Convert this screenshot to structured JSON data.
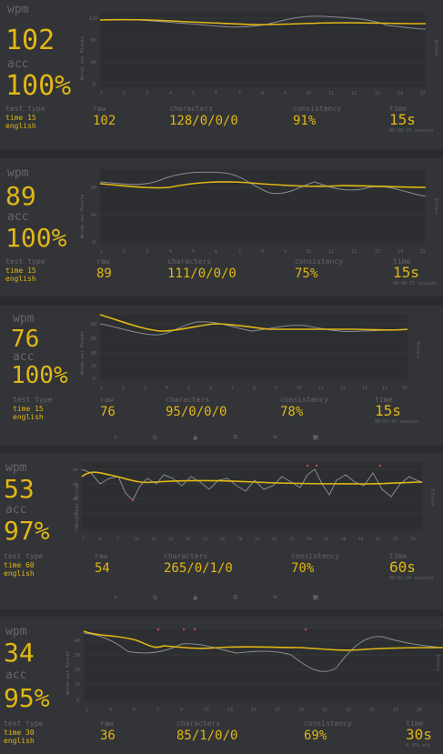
{
  "panels": [
    {
      "wpm_label": "wpm",
      "wpm": "102",
      "acc_label": "acc",
      "acc": "100%",
      "test_type_label": "test type",
      "test_type": "time 15",
      "language": "english",
      "raw_label": "raw",
      "raw": "102",
      "characters_label": "characters",
      "characters": "128/0/0/0",
      "consistency_label": "consistency",
      "consistency": "91%",
      "time_label": "time",
      "time": "15s",
      "time_note": "00:00:15 session",
      "y_axis_label": "Words per Minute",
      "y2_axis_label": "Errors",
      "y_ticks": [
        "120",
        "80",
        "40",
        "0"
      ],
      "x_ticks": [
        "1",
        "2",
        "3",
        "4",
        "5",
        "6",
        "7",
        "8",
        "9",
        "10",
        "11",
        "12",
        "13",
        "14",
        "15"
      ]
    },
    {
      "wpm_label": "wpm",
      "wpm": "89",
      "acc_label": "acc",
      "acc": "100%",
      "test_type_label": "test type",
      "test_type": "time 15",
      "language": "english",
      "raw_label": "raw",
      "raw": "89",
      "characters_label": "characters",
      "characters": "111/0/0/0",
      "consistency_label": "consistency",
      "consistency": "75%",
      "time_label": "time",
      "time": "15s",
      "time_note": "00:00:15 session",
      "y_axis_label": "Words per Minute",
      "y2_axis_label": "Errors",
      "y_ticks": [
        "80",
        "40",
        "0"
      ],
      "x_ticks": [
        "1",
        "2",
        "3",
        "4",
        "5",
        "6",
        "7",
        "8",
        "9",
        "10",
        "11",
        "12",
        "13",
        "14",
        "15"
      ]
    },
    {
      "wpm_label": "wpm",
      "wpm": "76",
      "acc_label": "acc",
      "acc": "100%",
      "test_type_label": "test type",
      "test_type": "time 15",
      "language": "english",
      "raw_label": "raw",
      "raw": "76",
      "characters_label": "characters",
      "characters": "95/0/0/0",
      "consistency_label": "consistency",
      "consistency": "78%",
      "time_label": "time",
      "time": "15s",
      "time_note": "00:00:45 session",
      "y_axis_label": "Words per Minute",
      "y2_axis_label": "Errors",
      "y_ticks": [
        "80",
        "60",
        "40",
        "20",
        "0"
      ],
      "x_ticks": [
        "1",
        "2",
        "3",
        "4",
        "5",
        "6",
        "7",
        "8",
        "9",
        "10",
        "11",
        "12",
        "13",
        "14",
        "15"
      ]
    },
    {
      "wpm_label": "wpm",
      "wpm": "53",
      "acc_label": "acc",
      "acc": "97%",
      "test_type_label": "test type",
      "test_type": "time 60",
      "language": "english",
      "raw_label": "raw",
      "raw": "54",
      "characters_label": "characters",
      "characters": "265/0/1/0",
      "consistency_label": "consistency",
      "consistency": "70%",
      "time_label": "time",
      "time": "60s",
      "time_note": "00:01:00 session",
      "y_axis_label": "Words per Minute",
      "y2_axis_label": "Errors",
      "y_ticks": [
        "80",
        "60",
        "40",
        "20",
        "0"
      ],
      "x_ticks": [
        "1",
        "4",
        "7",
        "10",
        "13",
        "16",
        "19",
        "22",
        "25",
        "28",
        "31",
        "34",
        "37",
        "40",
        "43",
        "46",
        "49",
        "52",
        "55",
        "58"
      ]
    },
    {
      "wpm_label": "wpm",
      "wpm": "34",
      "acc_label": "acc",
      "acc": "95%",
      "test_type_label": "test type",
      "test_type": "time 30",
      "language": "english",
      "raw_label": "raw",
      "raw": "36",
      "characters_label": "characters",
      "characters": "85/1/0/0",
      "consistency_label": "consistency",
      "consistency": "69%",
      "time_label": "time",
      "time": "30s",
      "time_note": "0.35% afk",
      "y_axis_label": "Words per Minute",
      "y2_axis_label": "Errors",
      "y_ticks": [
        "40",
        "30",
        "20",
        "10",
        "0"
      ],
      "x_ticks": [
        "1",
        "3",
        "5",
        "7",
        "9",
        "11",
        "13",
        "15",
        "17",
        "19",
        "21",
        "23",
        "25",
        "27",
        "29"
      ]
    }
  ],
  "toolbar_icons": [
    "next-test-icon",
    "restart-icon",
    "warning-icon",
    "list-icon",
    "rewind-icon",
    "image-icon"
  ],
  "colors": {
    "background": "#323437",
    "accent": "#e2b714",
    "sub": "#646669",
    "raw_line": "#8a8b8d",
    "error": "#ca4754"
  }
}
